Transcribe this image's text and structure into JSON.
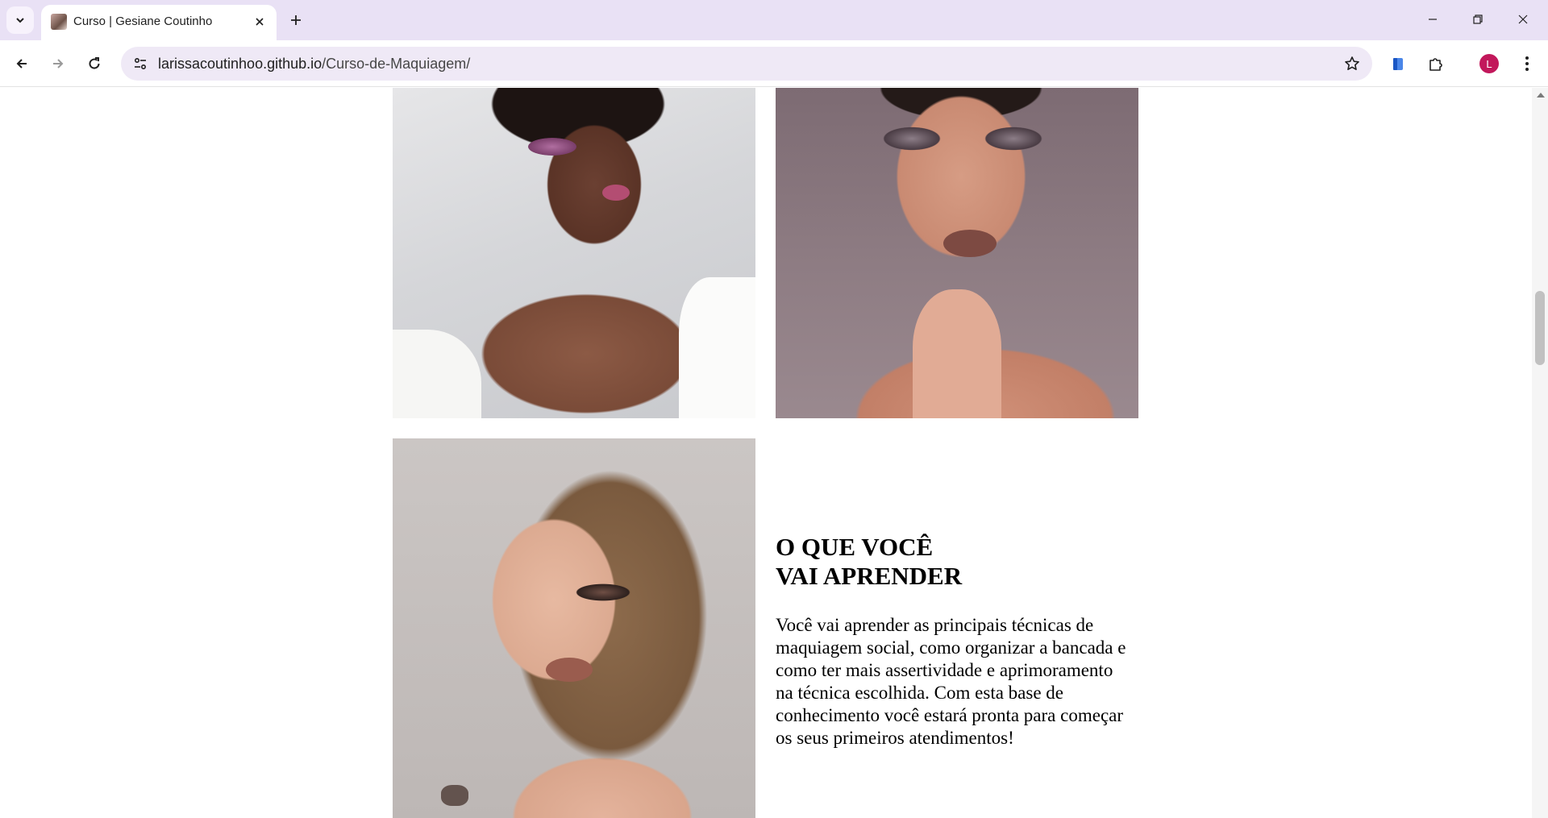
{
  "browser": {
    "tab_title": "Curso | Gesiane Coutinho",
    "url_host": "larissacoutinhoo.github.io",
    "url_path": "/Curso-de-Maquiagem/",
    "profile_initial": "L",
    "accent_color": "#c2185b"
  },
  "icons": {
    "tab_search": "chevron-down-icon",
    "tab_close": "close-icon",
    "new_tab": "plus-icon",
    "minimize": "minimize-icon",
    "restore": "restore-icon",
    "close_window": "close-icon",
    "back": "arrow-left-icon",
    "forward": "arrow-right-icon",
    "reload": "reload-icon",
    "site_info": "tune-icon",
    "bookmark": "star-icon",
    "side_panel": "side-panel-icon",
    "extensions": "puzzle-icon",
    "menu": "kebab-menu-icon"
  },
  "section": {
    "title": "O QUE VOCÊ VAI APRENDER",
    "text": "Você vai aprender as principais técnicas de maquiagem social, como organizar a bancada e como ter mais assertividade e aprimoramento na técnica escolhida. Com esta base de conhecimento você estará pronta para começar os seus primeiros atendimentos!"
  }
}
